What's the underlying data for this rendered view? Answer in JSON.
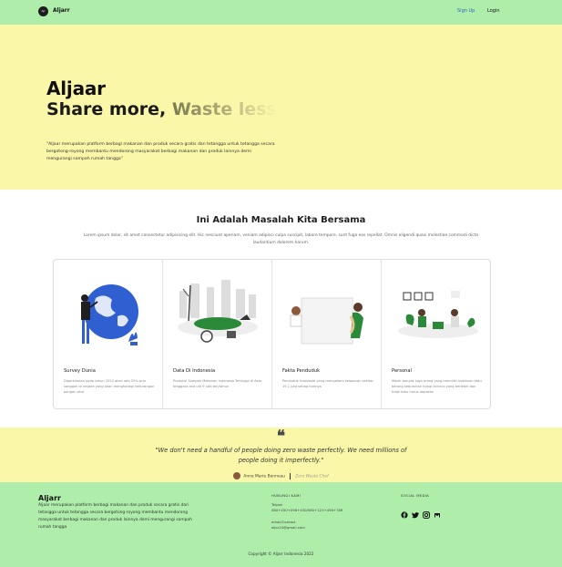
{
  "nav": {
    "logo_text": "Ajr",
    "brand": "Aljarr",
    "signup": "Sign Up",
    "login": "Login"
  },
  "hero": {
    "title": "Aljaar",
    "tagline_dark": "Share more, ",
    "tagline_fade": "Waste less",
    "description": "\"Aljaar merupakan platform berbagi makanan dan produk secara gratis dan tetangga untuk tetangga secara bergotong-royong membantu mendorong masyarakat berbagi makanan dan produk lainnya demi mengurangi sampah rumah tangga\""
  },
  "problem": {
    "title": "Ini Adalah Masalah Kita Bersama",
    "description": "Lorem ipsum dolor, sit amet consectetur adipisicing elit. Hic nesciunt aperiam, veniam adipisci culpa suscipit, labore tempore, sunt fuga eos repellat. Omnis eligendi quasi molestiae commodi dicta laudantium dolorem harum."
  },
  "cards": [
    {
      "title": "Survey Dunia",
      "desc": "Diperkirakan pada tahun 2022 akan ada 20% pria sanggah di negara yang akan menghadapi kekurangan pangan akut"
    },
    {
      "title": "Data Di Indonesia",
      "desc": "Produksi Sampah Makanan Indonesia Tertinggi di Asia, tenggara and ulit 9 juta ton/tahun"
    },
    {
      "title": "Fakta Penduduk",
      "desc": "Penduduk Indonesia yang mengalami kelaparan sekitar 19,1 juta setiap harinya"
    },
    {
      "title": "Personal",
      "desc": "Masih banyak juga orang yang memiliki makanan atau barang kebutuhan hidup lainnya yang berlebih dan tidak tahu harus dapakan"
    }
  ],
  "quote": {
    "mark": "❝",
    "text": "\"We don't need a handful of people doing zero waste perfectly. We need millions of people doing it imperfectly.\"",
    "author": "Anne Marie Bonneau",
    "role": "Zero Waste Chef"
  },
  "footer": {
    "brand": "Aljarr",
    "description": "Aljaar merupakan platform berbagi makanan dan produk secara gratis dari tetangga untuk tetangga secara bergotong-royong membantu mendorong masyarakat berbagi makanan dan produk lainnya demi mengurangi sampah rumah tangga",
    "contact_head": "HUBUNGI KAMI",
    "phone_label": "Telpon",
    "phone": "080+450+098+450/080+123+456+789",
    "email_label": "email/Contact",
    "email": "aljar24@gmail.com",
    "social_head": "SOCIAL MEDIA",
    "copyright": "Copyright © Aljarr Indonesia 2022"
  },
  "colors": {
    "green": "#aeeeaa",
    "yellow": "#fbf7a8",
    "link_blue": "#2f63c9"
  }
}
